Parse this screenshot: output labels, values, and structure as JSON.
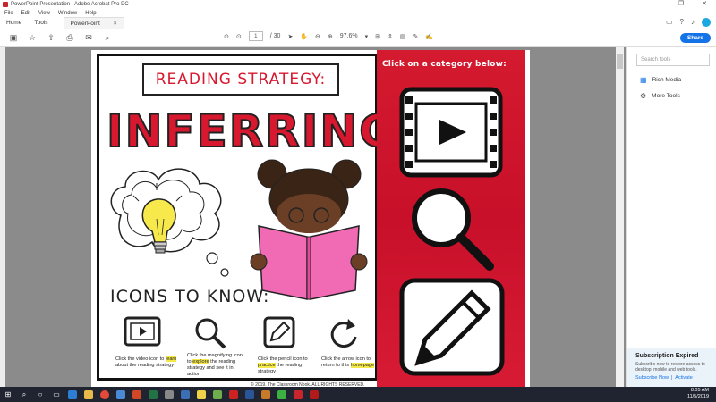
{
  "window": {
    "title": "PowerPoint Presentation - Adobe Acrobat Pro DC"
  },
  "menu": [
    "File",
    "Edit",
    "View",
    "Window",
    "Help"
  ],
  "tabs": {
    "home": "Home",
    "tools": "Tools",
    "doc": "PowerPoint Present...",
    "close": "×"
  },
  "toolbar": {
    "page_current": "1",
    "page_total": "/ 30",
    "zoom": "97.6%"
  },
  "share_label": "Share",
  "document": {
    "title_top": "READING STRATEGY:",
    "title_main": "INFERRING",
    "icons_heading": "ICONS TO KNOW:",
    "captions": [
      {
        "pre": "Click the video icon to ",
        "hl": "learn",
        "post": " about the reading strategy"
      },
      {
        "pre": "Click the magnifying icon to ",
        "hl": "explore",
        "post": " the reading strategy and see it in action"
      },
      {
        "pre": "Click the pencil icon to ",
        "hl": "practice",
        "post": " the reading strategy"
      },
      {
        "pre": "Click the arrow icon to return to this ",
        "hl": "homepage",
        "post": ""
      }
    ],
    "copyright": "© 2019. The Classroom Nook. ALL RIGHTS RESERVED.",
    "category_heading": "Click on a category below:"
  },
  "side_panel": {
    "search_placeholder": "Search tools",
    "items": [
      "Rich Media",
      "More Tools"
    ],
    "subscription": {
      "title": "Subscription Expired",
      "desc": "Subscribe now to restore access to desktop, mobile and web tools.",
      "subscribe": "Subscribe Now",
      "activate": "Activate"
    }
  },
  "taskbar": {
    "time": "8:05 AM",
    "date": "11/5/2019"
  },
  "colors": {
    "accent_red": "#d7182f",
    "highlight": "#f5e94a",
    "share_blue": "#1473e6"
  }
}
